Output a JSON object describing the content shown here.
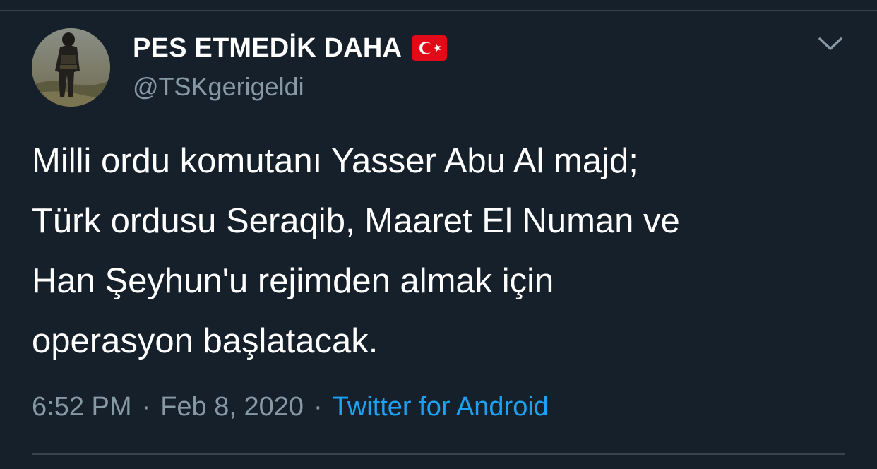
{
  "tweet": {
    "author": {
      "display_name": "PES ETMEDİK DAHA",
      "handle": "@TSKgerigeldi",
      "flag_icon": "turkey-flag-icon",
      "avatar_icon": "profile-avatar"
    },
    "text": "Milli ordu komutanı Yasser Abu Al majd;\nTürk ordusu Seraqib, Maaret El Numan ve\nHan Şeyhun'u rejimden almak için\noperasyon başlatacak.",
    "time": "6:52 PM",
    "date": "Feb 8, 2020",
    "separator": "·",
    "source": "Twitter for Android",
    "menu_icon": "chevron-down-icon"
  },
  "colors": {
    "background": "#15202b",
    "divider": "#38444d",
    "text_primary": "#ffffff",
    "text_secondary": "#8899a6",
    "link": "#1da1f2",
    "flag_red": "#e30a17"
  }
}
